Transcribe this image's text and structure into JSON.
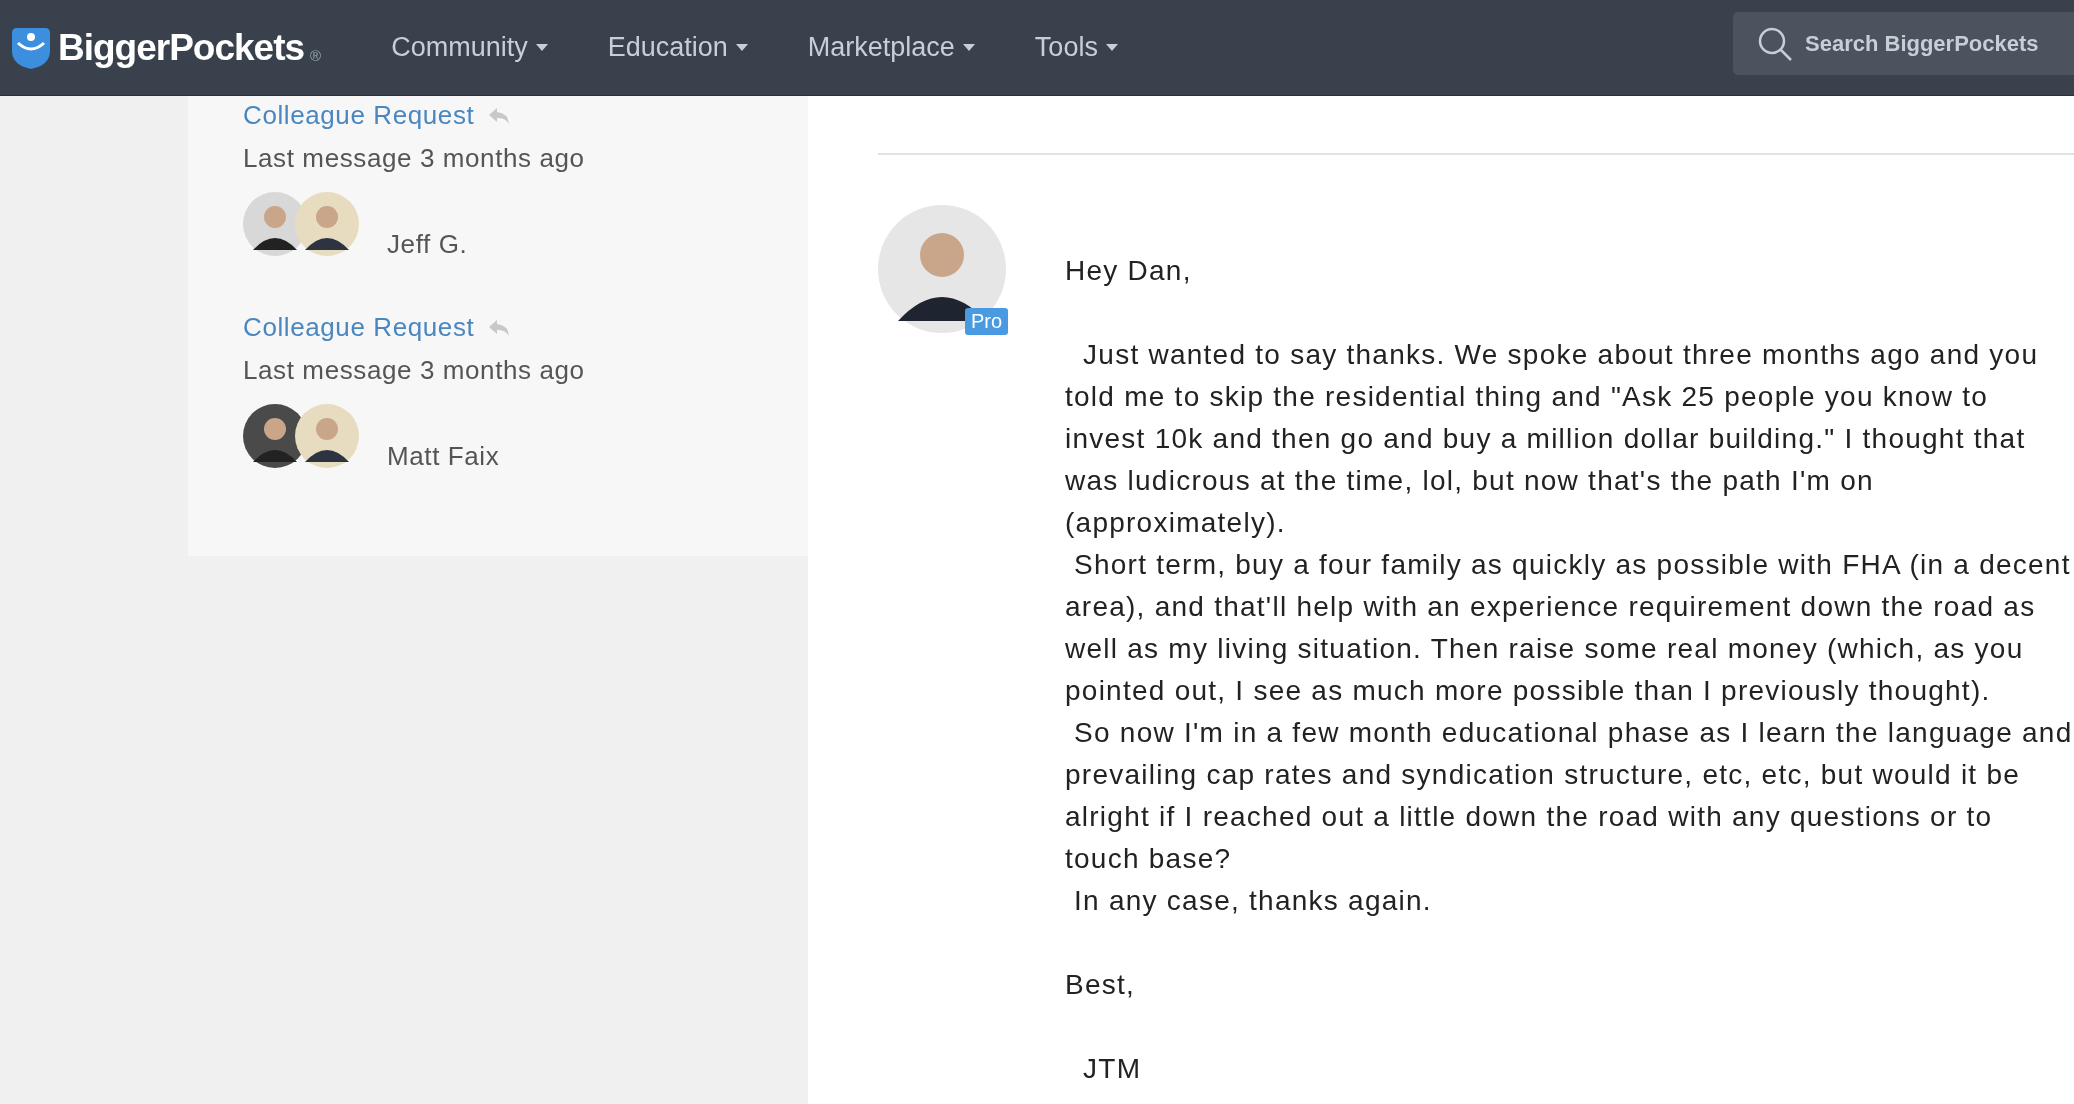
{
  "nav": {
    "logo": "BiggerPockets",
    "logo_mark": "®",
    "menu": [
      {
        "label": "Community"
      },
      {
        "label": "Education"
      },
      {
        "label": "Marketplace"
      },
      {
        "label": "Tools"
      }
    ],
    "search": {
      "placeholder": "Search BiggerPockets"
    }
  },
  "conversations": [
    {
      "title": "Colleague Request",
      "last_message": "Last message 3 months ago",
      "participant": "Jeff G."
    },
    {
      "title": "Colleague Request",
      "last_message": "Last message 3 months ago",
      "participant": "Matt Faix"
    }
  ],
  "message": {
    "badge": "Pro",
    "body": "Hey Dan,\n\n  Just wanted to say thanks. We spoke about three months ago and you told me to skip the residential thing and \"Ask 25 people you know to invest 10k and then go and buy a million dollar building.\" I thought that was ludicrous at the time, lol, but now that's the path I'm on (approximately).\n Short term, buy a four family as quickly as possible with FHA (in a decent area), and that'll help with an experience requirement down the road as well as my living situation. Then raise some real money (which, as you pointed out, I see as much more possible than I previously thought).\n So now I'm in a few month educational phase as I learn the language and prevailing cap rates and syndication structure, etc, etc, but would it be alright if I reached out a little down the road with any questions or to touch base?\n In any case, thanks again.\n\nBest,\n\n  JTM"
  }
}
